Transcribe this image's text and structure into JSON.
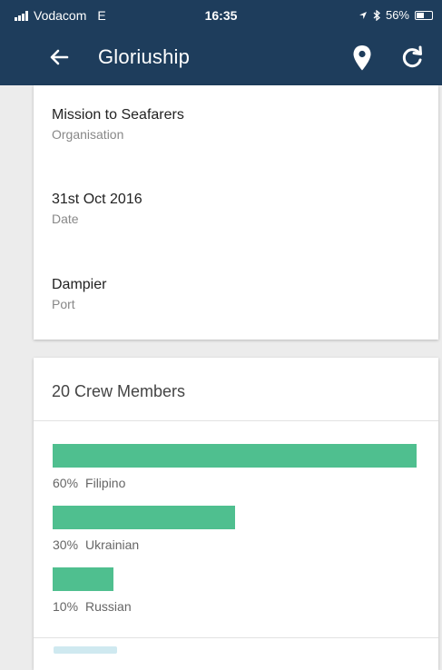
{
  "status_bar": {
    "carrier": "Vodacom",
    "network": "E",
    "time": "16:35",
    "battery": "56%",
    "battery_level": 0.56,
    "icons": [
      "signal-icon",
      "location-arrow-icon",
      "bluetooth-icon",
      "battery-icon"
    ]
  },
  "app_bar": {
    "title": "Gloriuship",
    "icons": [
      "back-arrow-icon",
      "map-pin-icon",
      "refresh-icon"
    ],
    "color": "#1e3d5c"
  },
  "info_card": {
    "items": [
      {
        "value": "Mission to Seafarers",
        "label": "Organisation"
      },
      {
        "value": "31st Oct 2016",
        "label": "Date"
      },
      {
        "value": "Dampier",
        "label": "Port"
      }
    ]
  },
  "crew": {
    "title": "20 Crew Members",
    "bar_color": "#4fbf8f",
    "entries": [
      {
        "percent": "60%",
        "nationality": "Filipino",
        "value": 0.6
      },
      {
        "percent": "30%",
        "nationality": "Ukrainian",
        "value": 0.3
      },
      {
        "percent": "10%",
        "nationality": "Russian",
        "value": 0.1
      }
    ]
  }
}
